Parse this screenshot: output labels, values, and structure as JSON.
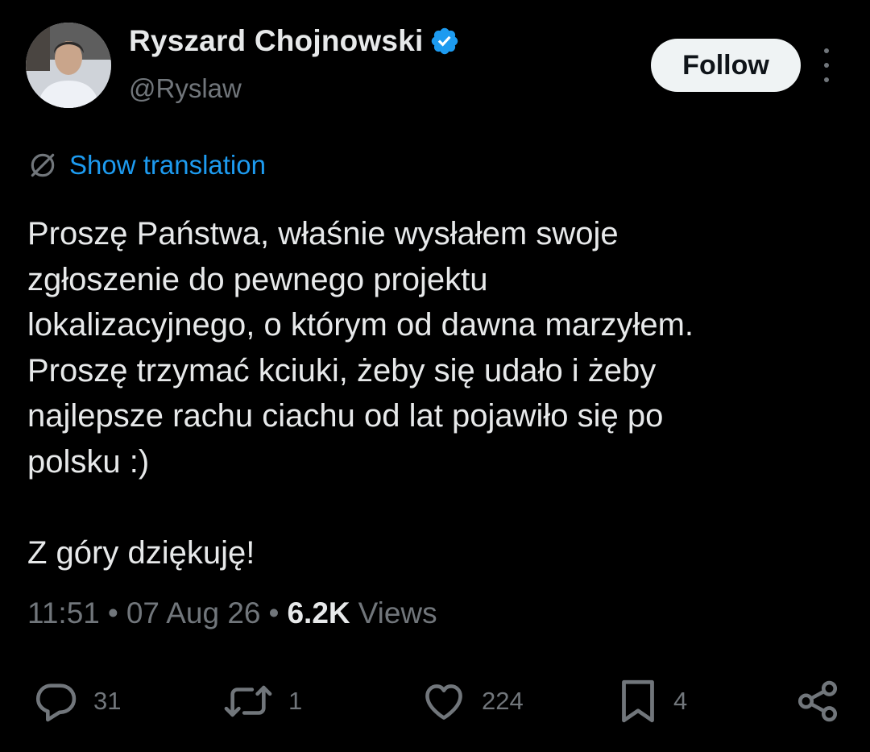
{
  "author": {
    "name": "Ryszard Chojnowski",
    "handle": "@Ryslaw",
    "verified": true
  },
  "follow_button": {
    "label": "Follow"
  },
  "translation": {
    "label": "Show translation"
  },
  "tweet": {
    "text": "Proszę Państwa, właśnie wysłałem swoje\nzgłoszenie do pewnego projektu\nlokalizacyjnego, o którym od dawna marzyłem.\nProszę trzymać kciuki, żeby się udało i żeby\nnajlepsze rachu ciachu od lat pojawiło się po\npolsku :)\n\nZ góry dziękuję!"
  },
  "meta": {
    "time": "11:51",
    "separator": "•",
    "date": "07 Aug 26",
    "views_count": "6.2K",
    "views_label": "Views"
  },
  "actions": {
    "replies": "31",
    "reposts": "1",
    "likes": "224",
    "bookmarks": "4"
  },
  "icons": {
    "verified": "verified-badge-icon",
    "more": "more-vertical-icon",
    "translate": "translate-globe-icon",
    "reply": "reply-bubble-icon",
    "repost": "repost-arrows-icon",
    "like": "heart-icon",
    "bookmark": "bookmark-icon",
    "share": "share-icon"
  },
  "colors": {
    "background": "#000000",
    "text": "#e7e9ea",
    "muted": "#71767b",
    "accent": "#1d9bf0",
    "follow_bg": "#eff3f4"
  }
}
